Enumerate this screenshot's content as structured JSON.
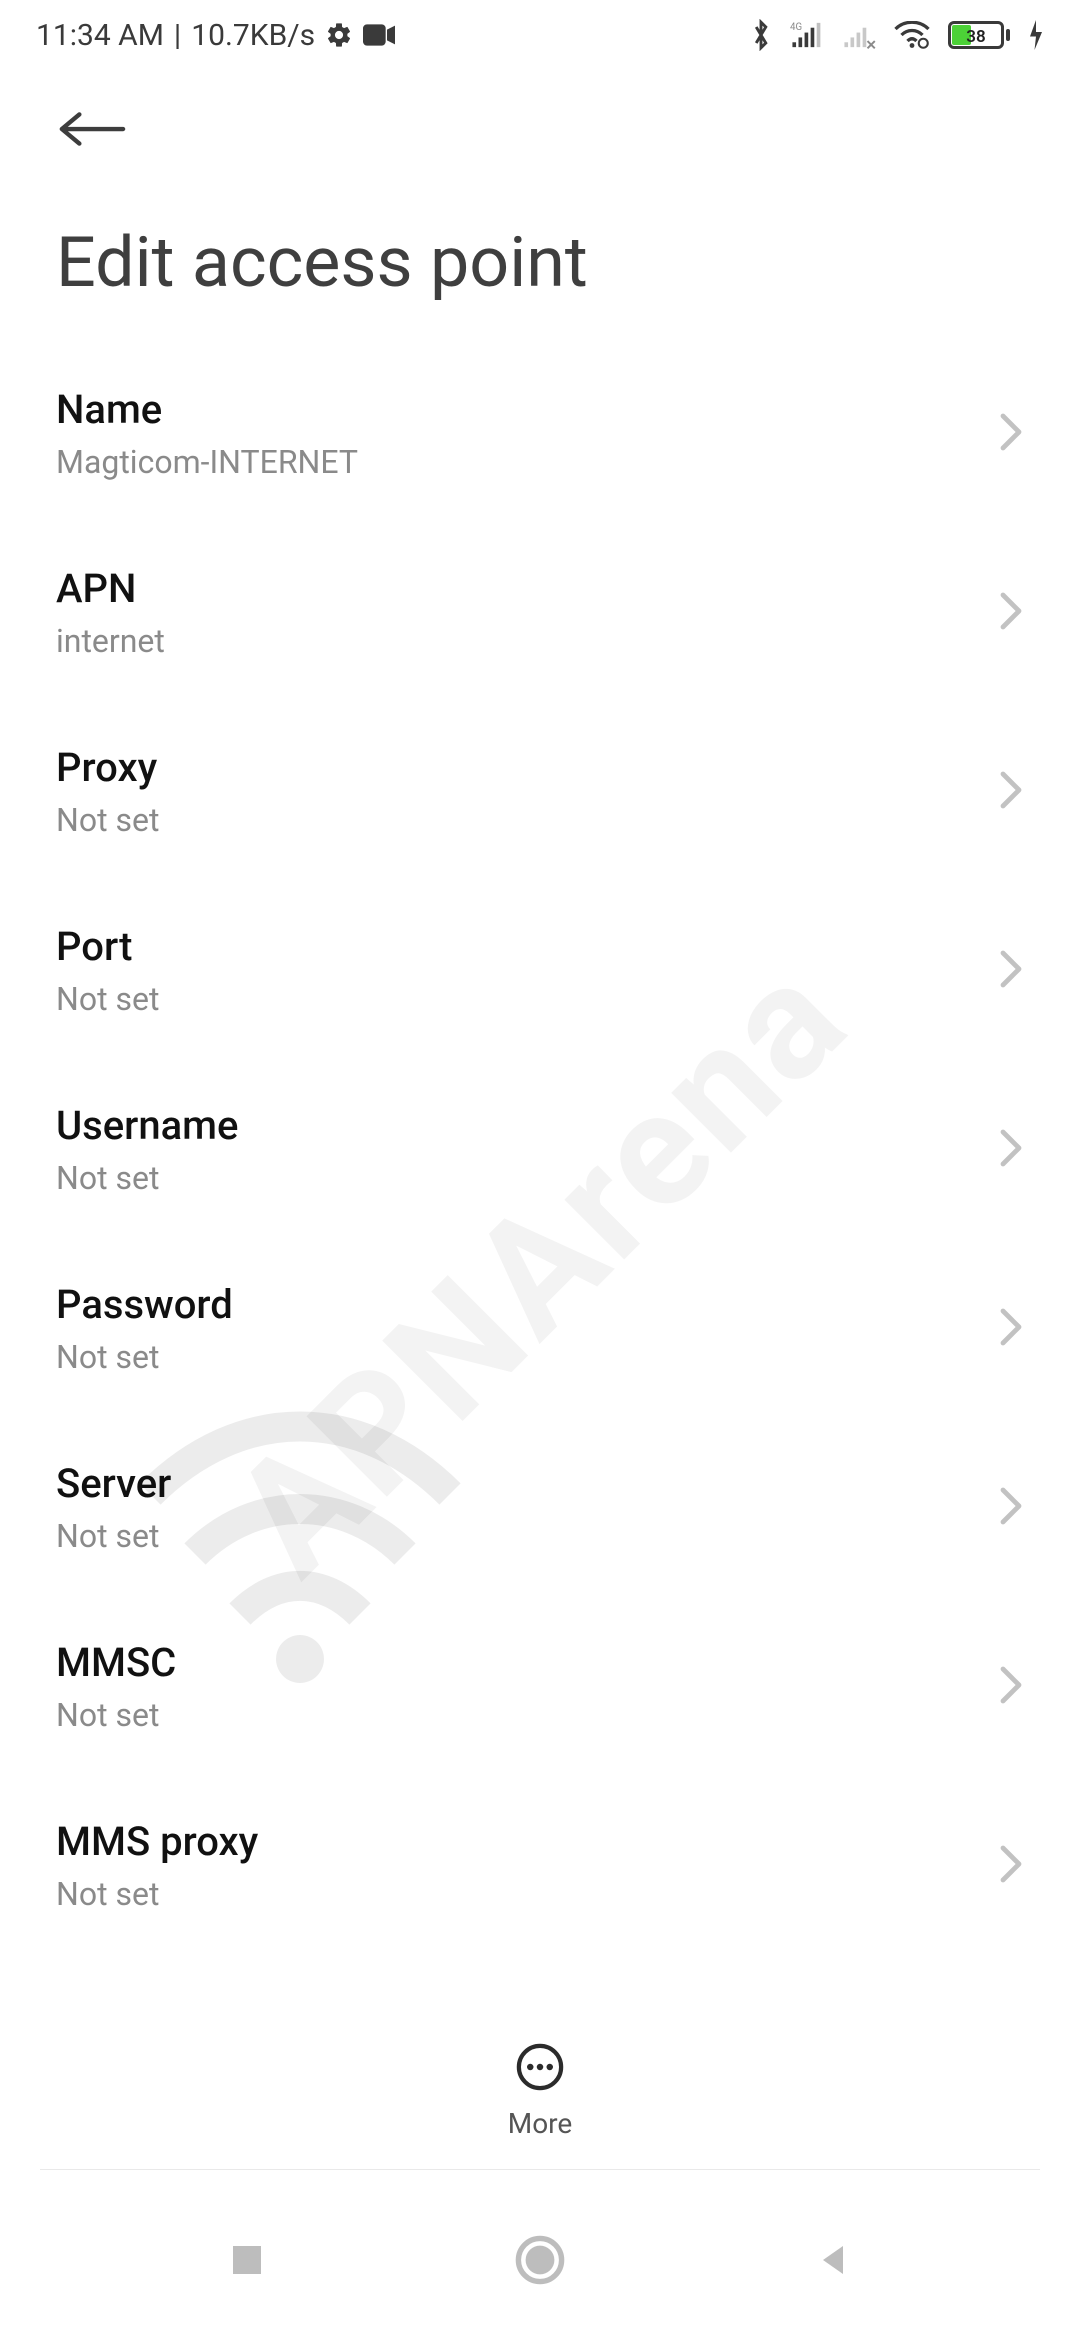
{
  "statusbar": {
    "time": "11:34 AM",
    "data_rate": "10.7KB/s",
    "battery_pct": "38"
  },
  "header": {
    "title": "Edit access point"
  },
  "rows": [
    {
      "label": "Name",
      "value": "Magticom-INTERNET"
    },
    {
      "label": "APN",
      "value": "internet"
    },
    {
      "label": "Proxy",
      "value": "Not set"
    },
    {
      "label": "Port",
      "value": "Not set"
    },
    {
      "label": "Username",
      "value": "Not set"
    },
    {
      "label": "Password",
      "value": "Not set"
    },
    {
      "label": "Server",
      "value": "Not set"
    },
    {
      "label": "MMSC",
      "value": "Not set"
    },
    {
      "label": "MMS proxy",
      "value": "Not set"
    }
  ],
  "more_label": "More",
  "watermark": "APNArena"
}
